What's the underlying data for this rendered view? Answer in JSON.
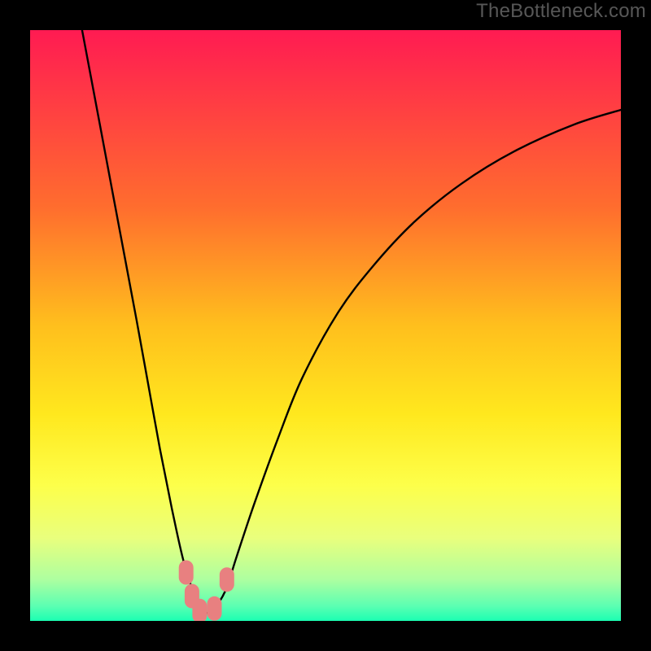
{
  "watermark": "TheBottleneck.com",
  "chart_data": {
    "type": "line",
    "title": "",
    "xlabel": "",
    "ylabel": "",
    "xlim": [
      0,
      100
    ],
    "ylim": [
      0,
      100
    ],
    "grid": false,
    "legend": false,
    "background": {
      "type": "vertical-gradient",
      "stops": [
        {
          "pos": 0.0,
          "color": "#ff1b52"
        },
        {
          "pos": 0.3,
          "color": "#ff6d2e"
        },
        {
          "pos": 0.5,
          "color": "#ffbf1d"
        },
        {
          "pos": 0.65,
          "color": "#ffe81e"
        },
        {
          "pos": 0.77,
          "color": "#fdff4a"
        },
        {
          "pos": 0.86,
          "color": "#e9ff7d"
        },
        {
          "pos": 0.93,
          "color": "#adffa0"
        },
        {
          "pos": 0.975,
          "color": "#5bffb2"
        },
        {
          "pos": 1.0,
          "color": "#1bffb2"
        }
      ]
    },
    "series": [
      {
        "name": "bottleneck-curve",
        "color": "#000000",
        "x": [
          8.8,
          12,
          15,
          18,
          20,
          22,
          24,
          26,
          28,
          29.5,
          31,
          33,
          35,
          38,
          42,
          46,
          52,
          58,
          65,
          73,
          82,
          92,
          100
        ],
        "y": [
          100,
          83,
          67,
          51,
          40,
          29,
          19,
          10,
          4,
          1.5,
          2,
          5,
          11,
          20,
          31,
          41,
          52,
          60,
          67.5,
          74,
          79.5,
          84,
          86.5
        ]
      }
    ],
    "markers": [
      {
        "name": "pt-left-upper",
        "x": 26.4,
        "y": 8.2,
        "color": "#e88080"
      },
      {
        "name": "pt-left-lower",
        "x": 27.4,
        "y": 4.2,
        "color": "#e88080"
      },
      {
        "name": "pt-bottom-left",
        "x": 28.7,
        "y": 1.7,
        "color": "#e88080"
      },
      {
        "name": "pt-bottom-right",
        "x": 31.2,
        "y": 2.1,
        "color": "#e88080"
      },
      {
        "name": "pt-right-upper",
        "x": 33.3,
        "y": 7.0,
        "color": "#e88080"
      }
    ]
  }
}
